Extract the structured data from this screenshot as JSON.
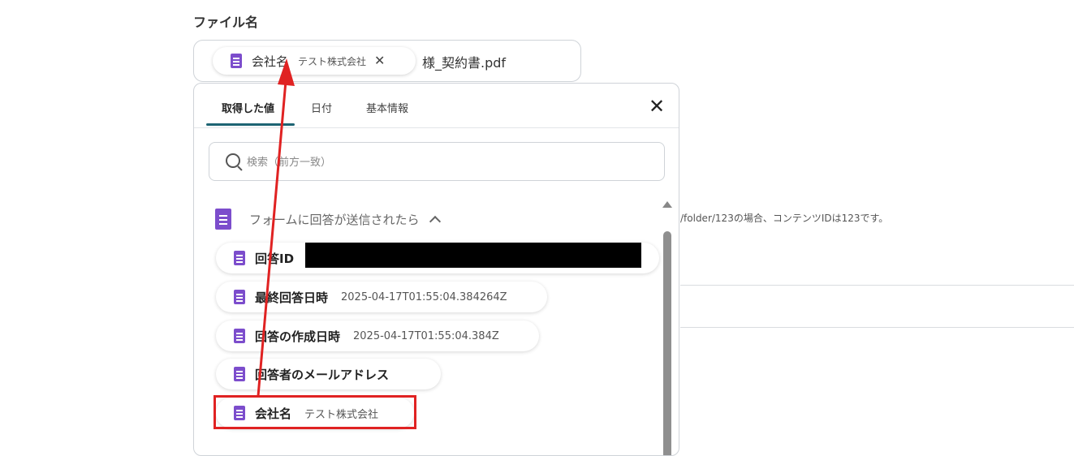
{
  "field": {
    "label": "ファイル名"
  },
  "chip": {
    "label": "会社名",
    "value": "テスト株式会社"
  },
  "filename": {
    "suffix": "様_契約書.pdf"
  },
  "popup": {
    "tabs": [
      {
        "label": "取得した値"
      },
      {
        "label": "日付"
      },
      {
        "label": "基本情報"
      }
    ],
    "search": {
      "placeholder": "検索（前方一致）"
    },
    "section": {
      "title": "フォームに回答が送信されたら"
    },
    "items": [
      {
        "label": "回答ID",
        "value": ""
      },
      {
        "label": "最終回答日時",
        "value": "2025-04-17T01:55:04.384264Z"
      },
      {
        "label": "回答の作成日時",
        "value": "2025-04-17T01:55:04.384Z"
      },
      {
        "label": "回答者のメールアドレス",
        "value": ""
      },
      {
        "label": "会社名",
        "value": "テスト株式会社"
      }
    ]
  },
  "background": {
    "note": "/folder/123の場合、コンテンツIDは123です。"
  },
  "colors": {
    "accent_tab": "#1d6473",
    "doc_icon": "#7c4dcc",
    "annotation": "#e02222"
  }
}
